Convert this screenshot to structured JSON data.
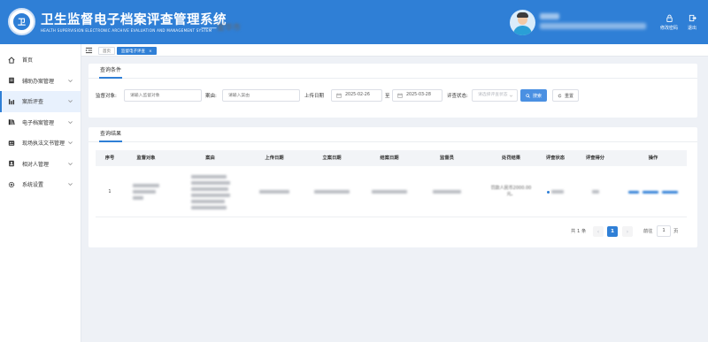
{
  "header": {
    "title": "卫生监督电子档案评查管理系统",
    "subtitle": "HEALTH SUPERVISION ELECTRONIC ARCHIVE EVALUATION AND MANAGEMENT SYSTEM",
    "region_prefix": "——",
    "region_name": "金华市",
    "change_password_label": "修改密码",
    "logout_label": "退出",
    "logo_glyph": "卫"
  },
  "sidebar": {
    "items": [
      {
        "label": "首页",
        "icon": "home-icon"
      },
      {
        "label": "辅助办案管理",
        "icon": "case-file-icon"
      },
      {
        "label": "案后评查",
        "icon": "chart-icon"
      },
      {
        "label": "电子档案管理",
        "icon": "archive-icon"
      },
      {
        "label": "现场执法文书管理",
        "icon": "document-icon"
      },
      {
        "label": "相对人管理",
        "icon": "person-icon"
      },
      {
        "label": "系统设置",
        "icon": "gear-icon"
      }
    ]
  },
  "tabs": {
    "home": "首页",
    "current": "监督电子评查",
    "close": "×"
  },
  "query": {
    "title": "查询条件",
    "target_label": "监督对象:",
    "target_placeholder": "请输入监督对象",
    "case_label": "案由:",
    "case_placeholder": "请输入案由",
    "upload_label": "上传日期",
    "date_from": "2025-02-26",
    "date_sep": "至",
    "date_to": "2025-03-28",
    "status_label": "评查状态:",
    "status_placeholder": "请选择评查状态",
    "search_button": "搜索",
    "reset_button": "重置"
  },
  "result": {
    "title": "查询结果",
    "columns": [
      "序号",
      "监督对象",
      "案由",
      "上传日期",
      "立案日期",
      "结案日期",
      "监督员",
      "处罚结果",
      "评查状态",
      "评查得分",
      "操作"
    ],
    "rows": [
      {
        "index": "1",
        "penalty": "罚款人民币2000.00元。"
      }
    ]
  },
  "pagination": {
    "total": "共 1 条",
    "prev": "‹",
    "current_page": "1",
    "next": "›",
    "goto_label": "前往",
    "goto_value": "1",
    "page_unit": "页"
  },
  "colors": {
    "primary": "#2f7fd6",
    "background": "#eef1f6"
  }
}
